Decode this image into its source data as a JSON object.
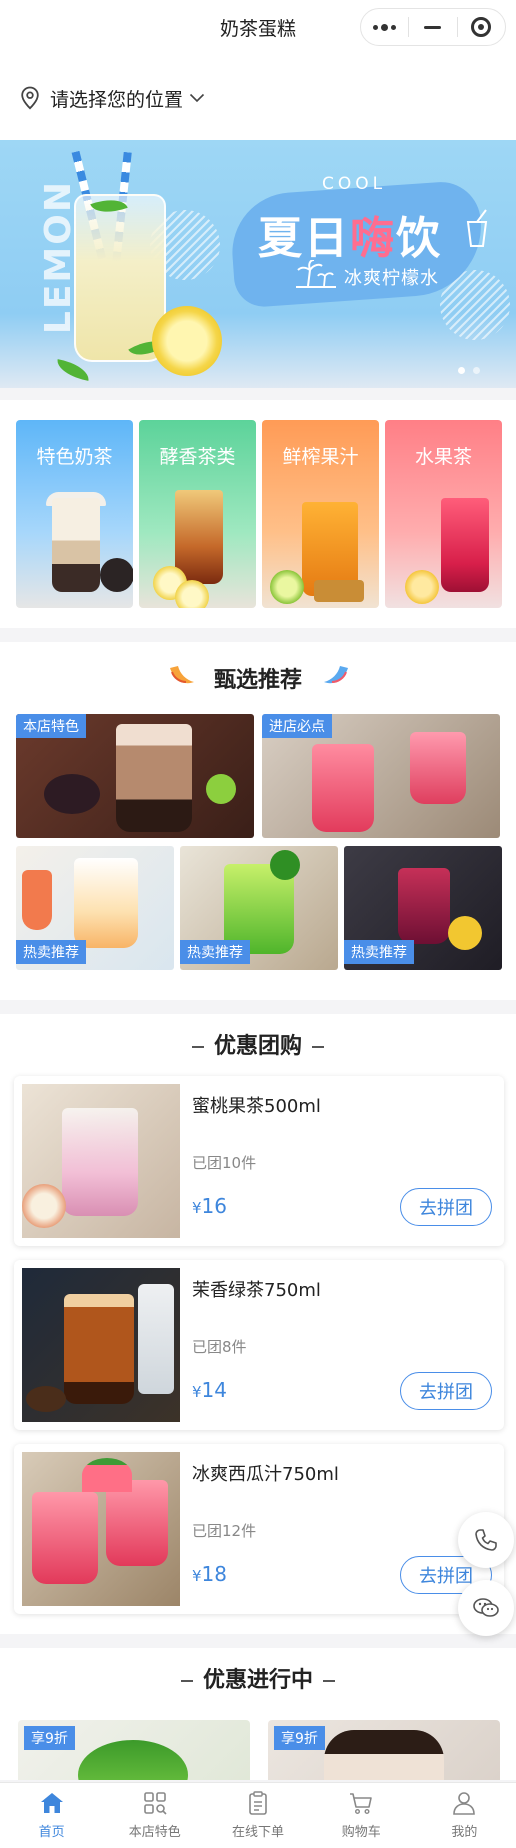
{
  "app": {
    "title": "奶茶蛋糕"
  },
  "location": {
    "label": "请选择您的位置"
  },
  "banner": {
    "side_word": "LEMON",
    "small_word": "COOL",
    "headline_a": "夏日",
    "headline_b": "嗨",
    "headline_c": "饮",
    "subtitle": "冰爽柠檬水"
  },
  "categories": [
    {
      "label": "特色奶茶"
    },
    {
      "label": "酵香茶类"
    },
    {
      "label": "鲜榨果汁"
    },
    {
      "label": "水果茶"
    }
  ],
  "recommend": {
    "title": "甄选推荐",
    "tiles": [
      {
        "tag": "本店特色"
      },
      {
        "tag": "进店必点"
      },
      {
        "tag": "热卖推荐"
      },
      {
        "tag": "热卖推荐"
      },
      {
        "tag": "热卖推荐"
      }
    ]
  },
  "group_buy": {
    "title": "优惠团购",
    "currency": "¥",
    "items": [
      {
        "name": "蜜桃果茶500ml",
        "sold": "已团10件",
        "price": "16",
        "button": "去拼团"
      },
      {
        "name": "茉香绿茶750ml",
        "sold": "已团8件",
        "price": "14",
        "button": "去拼团"
      },
      {
        "name": "冰爽西瓜汁750ml",
        "sold": "已团12件",
        "price": "18",
        "button": "去拼团"
      }
    ]
  },
  "promotions": {
    "title": "优惠进行中",
    "items": [
      {
        "tag": "享9折"
      },
      {
        "tag": "享9折"
      }
    ]
  },
  "tabbar": [
    {
      "label": "首页",
      "icon": "home-icon",
      "active": true
    },
    {
      "label": "本店特色",
      "icon": "grid-icon",
      "active": false
    },
    {
      "label": "在线下单",
      "icon": "clipboard-icon",
      "active": false
    },
    {
      "label": "购物车",
      "icon": "cart-icon",
      "active": false
    },
    {
      "label": "我的",
      "icon": "user-icon",
      "active": false
    }
  ],
  "colors": {
    "accent": "#3e86dc",
    "tag_bg": "#4a8ee8"
  }
}
